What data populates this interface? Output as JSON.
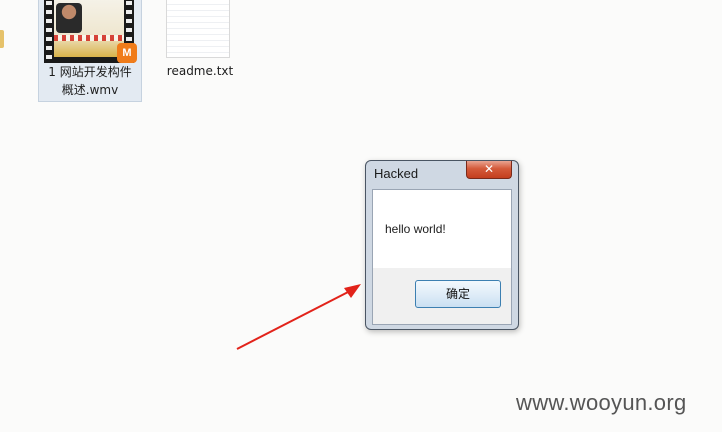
{
  "desktop": {
    "files": [
      {
        "name_line1": "1 网站开发构件",
        "name_line2": "概述.wmv",
        "badge": "M"
      },
      {
        "name_line1": "readme.txt"
      }
    ]
  },
  "dialog": {
    "title": "Hacked",
    "close_glyph": "✕",
    "message": "hello world!",
    "ok_label": "确定"
  },
  "watermark": "www.wooyun.org",
  "colors": {
    "arrow": "#e2231a",
    "close_button": "#c8452a",
    "ok_border": "#3c7fb1"
  }
}
